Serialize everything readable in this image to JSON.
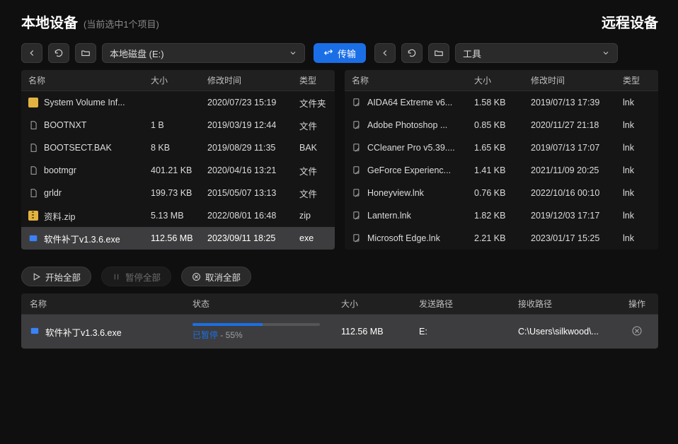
{
  "header": {
    "title_local": "本地设备",
    "selection_hint": "(当前选中1个项目)",
    "title_remote": "远程设备"
  },
  "toolbar": {
    "left_path": "本地磁盘 (E:)",
    "transfer_label": "传输",
    "right_path": "工具"
  },
  "columns": {
    "name": "名称",
    "size": "大小",
    "date": "修改时间",
    "type": "类型"
  },
  "left_files": [
    {
      "icon": "folder",
      "name": "System Volume Inf...",
      "size": "",
      "date": "2020/07/23 15:19",
      "type": "文件夹"
    },
    {
      "icon": "file",
      "name": "BOOTNXT",
      "size": "1 B",
      "date": "2019/03/19 12:44",
      "type": "文件"
    },
    {
      "icon": "file",
      "name": "BOOTSECT.BAK",
      "size": "8 KB",
      "date": "2019/08/29 11:35",
      "type": "BAK"
    },
    {
      "icon": "file",
      "name": "bootmgr",
      "size": "401.21 KB",
      "date": "2020/04/16 13:21",
      "type": "文件"
    },
    {
      "icon": "file",
      "name": "grldr",
      "size": "199.73 KB",
      "date": "2015/05/07 13:13",
      "type": "文件"
    },
    {
      "icon": "zip",
      "name": "资料.zip",
      "size": "5.13 MB",
      "date": "2022/08/01 16:48",
      "type": "zip"
    },
    {
      "icon": "exe",
      "name": "软件补丁v1.3.6.exe",
      "size": "112.56 MB",
      "date": "2023/09/11 18:25",
      "type": "exe",
      "selected": true
    }
  ],
  "right_files": [
    {
      "name": "AIDA64 Extreme v6...",
      "size": "1.58 KB",
      "date": "2019/07/13 17:39",
      "type": "lnk"
    },
    {
      "name": "Adobe Photoshop ...",
      "size": "0.85 KB",
      "date": "2020/11/27 21:18",
      "type": "lnk"
    },
    {
      "name": "CCleaner Pro v5.39....",
      "size": "1.65 KB",
      "date": "2019/07/13 17:07",
      "type": "lnk"
    },
    {
      "name": "GeForce Experienc...",
      "size": "1.41 KB",
      "date": "2021/11/09 20:25",
      "type": "lnk"
    },
    {
      "name": "Honeyview.lnk",
      "size": "0.76 KB",
      "date": "2022/10/16 00:10",
      "type": "lnk"
    },
    {
      "name": "Lantern.lnk",
      "size": "1.82 KB",
      "date": "2019/12/03 17:17",
      "type": "lnk"
    },
    {
      "name": "Microsoft Edge.lnk",
      "size": "2.21 KB",
      "date": "2023/01/17 15:25",
      "type": "lnk"
    }
  ],
  "queue_controls": {
    "start_all": "开始全部",
    "pause_all": "暂停全部",
    "cancel_all": "取消全部"
  },
  "queue_columns": {
    "name": "名称",
    "status": "状态",
    "size": "大小",
    "send_path": "发送路径",
    "recv_path": "接收路径",
    "op": "操作"
  },
  "queue": [
    {
      "icon": "exe",
      "name": "软件补丁v1.3.6.exe",
      "status_label": "已暂停",
      "percent_text": " - 55%",
      "percent": 55,
      "size": "112.56 MB",
      "src": "E:",
      "dst": "C:\\Users\\silkwood\\..."
    }
  ]
}
